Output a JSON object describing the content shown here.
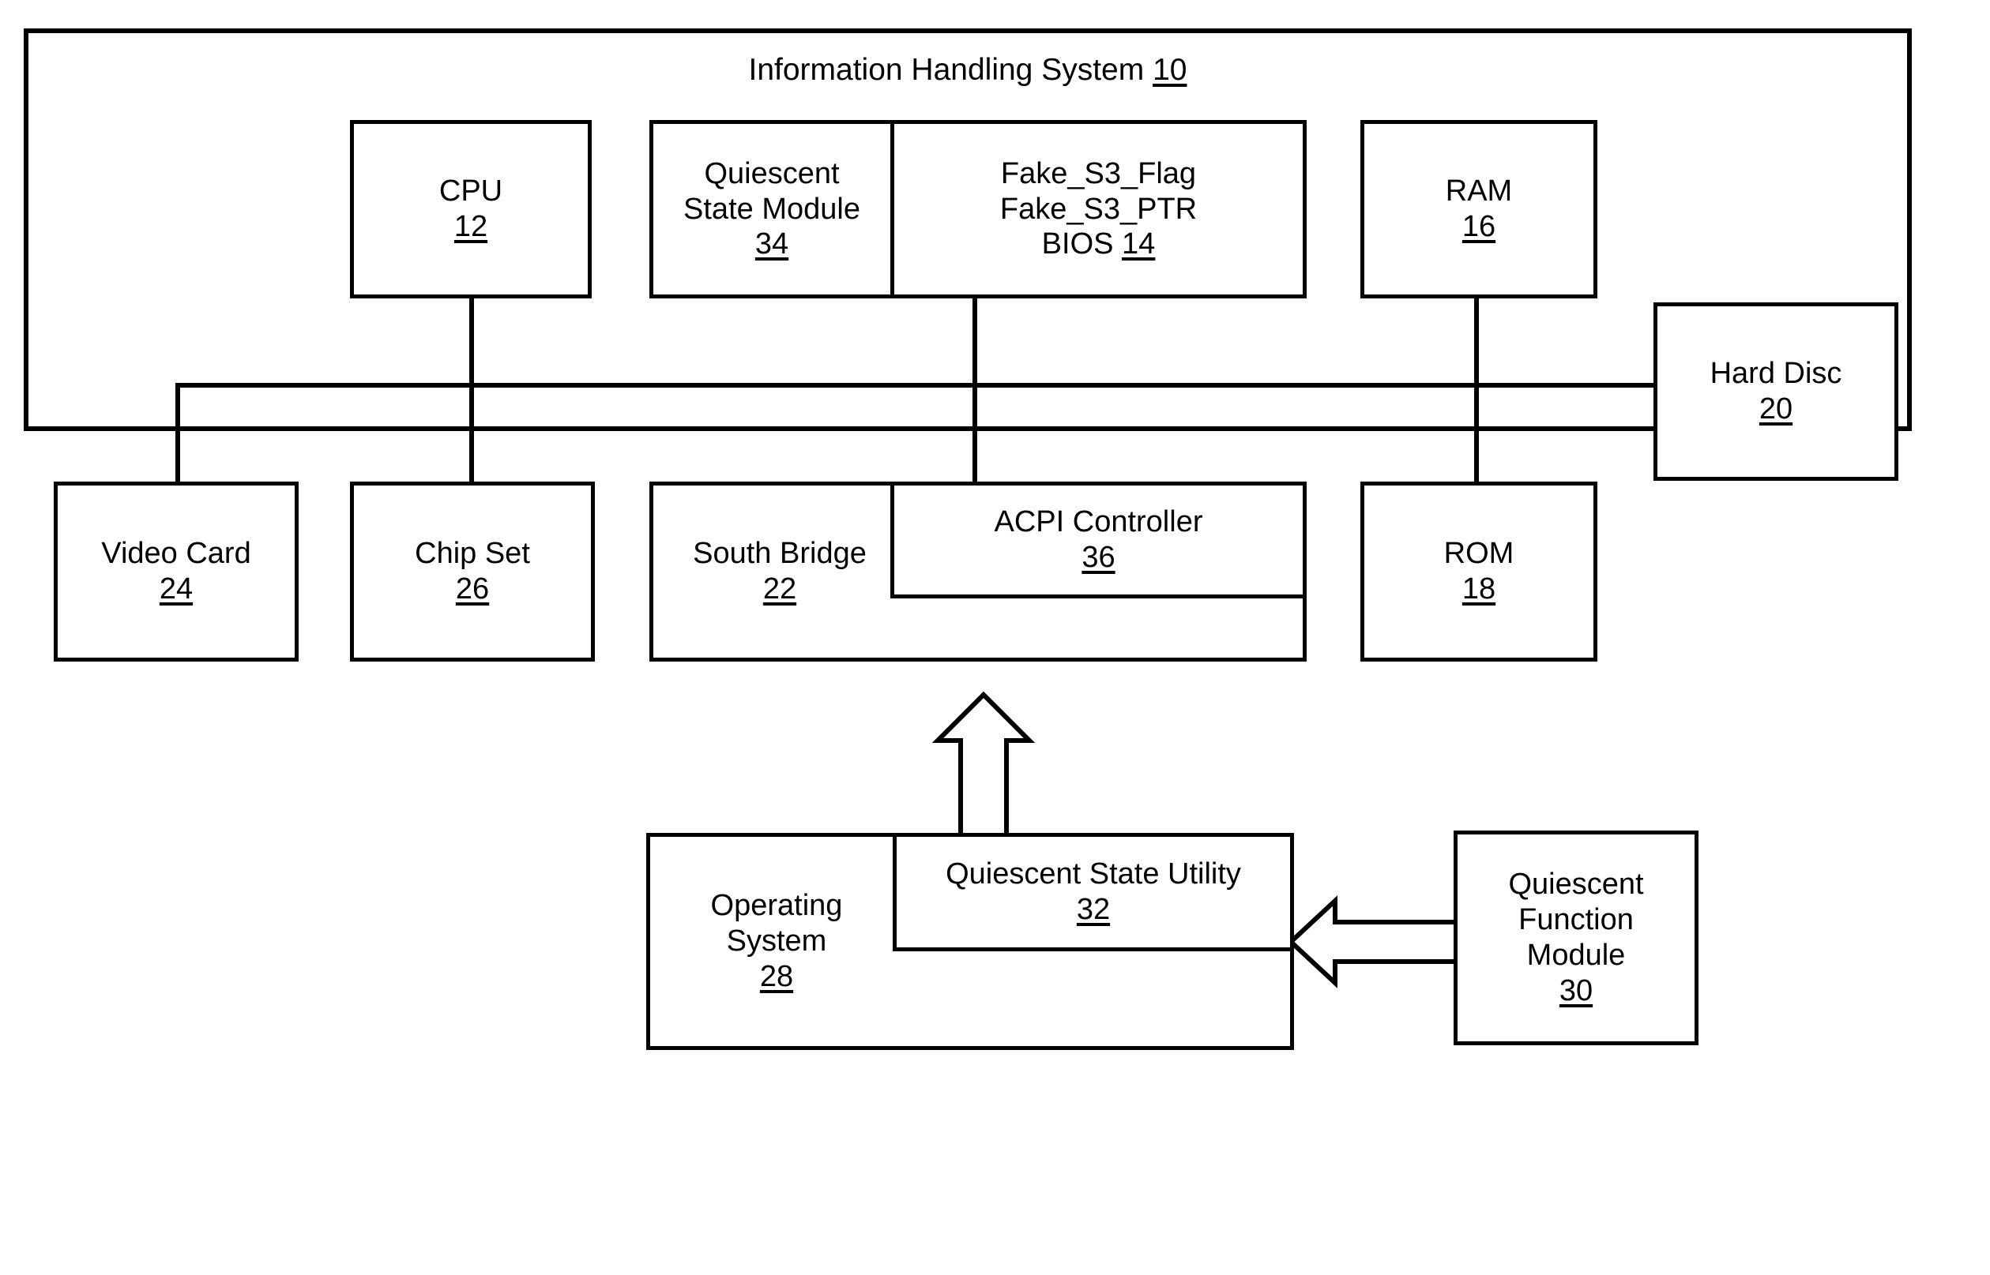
{
  "figure": {
    "system": {
      "title_text": "Information Handling System",
      "title_ref": "10"
    },
    "blocks": [
      {
        "id": "cpu",
        "label_lines": [
          "CPU"
        ],
        "ref": "12"
      },
      {
        "id": "qsm",
        "label_lines": [
          "Quiescent",
          "State Module"
        ],
        "ref": "34"
      },
      {
        "id": "bios",
        "label_lines": [
          "Fake_S3_Flag",
          "Fake_S3_PTR"
        ],
        "ref": "14",
        "ref_prefix": "BIOS"
      },
      {
        "id": "ram",
        "label_lines": [
          "RAM"
        ],
        "ref": "16"
      },
      {
        "id": "hard_disc",
        "label_lines": [
          "Hard Disc"
        ],
        "ref": "20"
      },
      {
        "id": "video_card",
        "label_lines": [
          "Video Card"
        ],
        "ref": "24"
      },
      {
        "id": "chip_set",
        "label_lines": [
          "Chip Set"
        ],
        "ref": "26"
      },
      {
        "id": "south_bridge",
        "label_lines": [
          "South Bridge"
        ],
        "ref": "22"
      },
      {
        "id": "acpi",
        "label_lines": [
          "ACPI Controller"
        ],
        "ref": "36"
      },
      {
        "id": "rom",
        "label_lines": [
          "ROM"
        ],
        "ref": "18"
      },
      {
        "id": "os",
        "label_lines": [
          "Operating",
          "System"
        ],
        "ref": "28"
      },
      {
        "id": "qsu",
        "label_lines": [
          "Quiescent State Utility"
        ],
        "ref": "32"
      },
      {
        "id": "qfm",
        "label_lines": [
          "Quiescent",
          "Function",
          "Module"
        ],
        "ref": "30"
      }
    ],
    "colors": {
      "stroke": "#000000",
      "fill": "#ffffff"
    }
  },
  "chart_data": {
    "type": "diagram",
    "title": "Information Handling System 10",
    "nodes": [
      {
        "id": "10",
        "name": "Information Handling System",
        "ref": "10",
        "role": "container"
      },
      {
        "id": "12",
        "name": "CPU",
        "ref": "12"
      },
      {
        "id": "34",
        "name": "Quiescent State Module",
        "ref": "34"
      },
      {
        "id": "14",
        "name": "BIOS",
        "ref": "14",
        "contents": [
          "Fake_S3_Flag",
          "Fake_S3_PTR"
        ]
      },
      {
        "id": "16",
        "name": "RAM",
        "ref": "16"
      },
      {
        "id": "20",
        "name": "Hard Disc",
        "ref": "20"
      },
      {
        "id": "24",
        "name": "Video Card",
        "ref": "24"
      },
      {
        "id": "26",
        "name": "Chip Set",
        "ref": "26"
      },
      {
        "id": "22",
        "name": "South Bridge",
        "ref": "22"
      },
      {
        "id": "36",
        "name": "ACPI Controller",
        "ref": "36",
        "parent": "22"
      },
      {
        "id": "18",
        "name": "ROM",
        "ref": "18"
      },
      {
        "id": "28",
        "name": "Operating System",
        "ref": "28"
      },
      {
        "id": "32",
        "name": "Quiescent State Utility",
        "ref": "32",
        "parent": "28"
      },
      {
        "id": "30",
        "name": "Quiescent Function Module",
        "ref": "30"
      }
    ],
    "edges": [
      {
        "from": "12",
        "to": "bus",
        "style": "line"
      },
      {
        "from": "14",
        "to": "bus",
        "style": "line"
      },
      {
        "from": "16",
        "to": "bus",
        "style": "line"
      },
      {
        "from": "bus",
        "to": "20",
        "style": "line"
      },
      {
        "from": "bus",
        "to": "24",
        "style": "line"
      },
      {
        "from": "bus",
        "to": "26",
        "style": "line"
      },
      {
        "from": "bus",
        "to": "22",
        "style": "line"
      },
      {
        "from": "bus",
        "to": "18",
        "style": "line"
      },
      {
        "from": "28",
        "to": "10",
        "style": "block-arrow-up"
      },
      {
        "from": "30",
        "to": "28",
        "style": "block-arrow-left"
      }
    ]
  }
}
